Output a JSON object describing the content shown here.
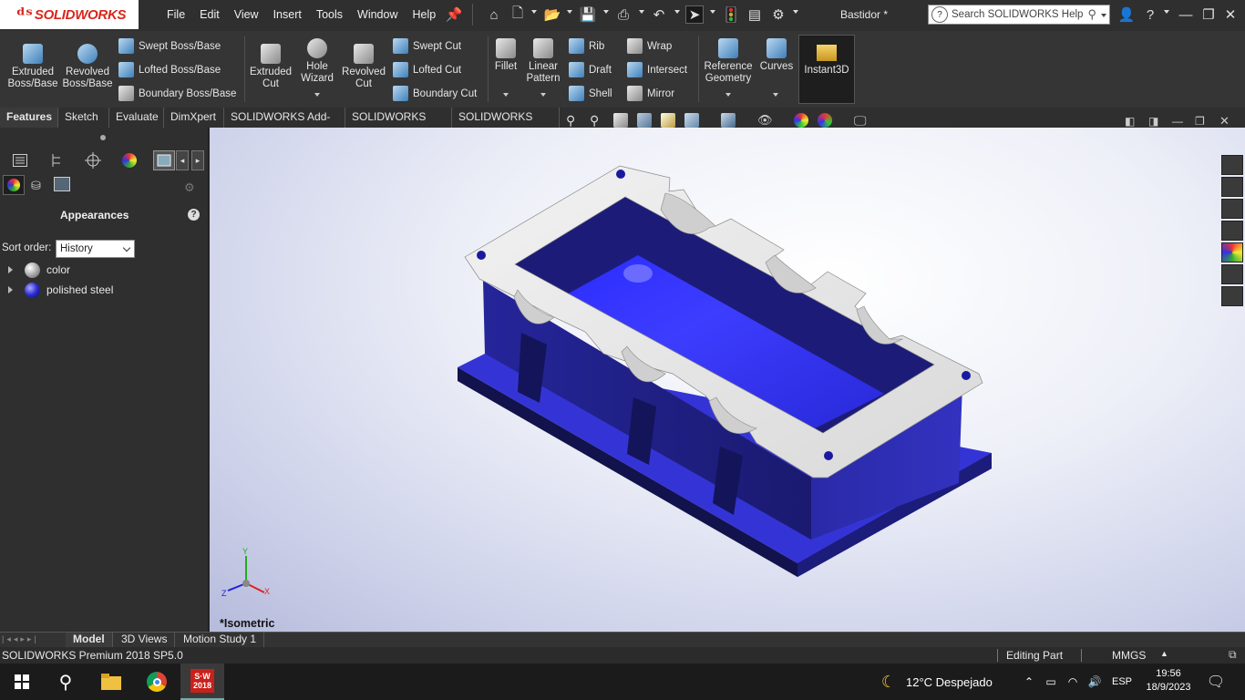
{
  "titlebar": {
    "logo_text": "SOLIDWORKS",
    "menu": [
      "File",
      "Edit",
      "View",
      "Insert",
      "Tools",
      "Window",
      "Help"
    ],
    "document_title": "Bastidor *",
    "search_placeholder": "Search SOLIDWORKS Help"
  },
  "ribbon": {
    "large": [
      {
        "label": "Extruded Boss/Base"
      },
      {
        "label": "Revolved Boss/Base"
      },
      {
        "label": "Extruded Cut"
      },
      {
        "label": "Hole Wizard"
      },
      {
        "label": "Revolved Cut"
      },
      {
        "label": "Fillet"
      },
      {
        "label": "Linear Pattern"
      },
      {
        "label": "Reference Geometry"
      },
      {
        "label": "Curves"
      },
      {
        "label": "Instant3D"
      }
    ],
    "small_boss": [
      "Swept Boss/Base",
      "Lofted Boss/Base",
      "Boundary Boss/Base"
    ],
    "small_cut": [
      "Swept Cut",
      "Lofted Cut",
      "Boundary Cut"
    ],
    "small_features_a": [
      "Rib",
      "Draft",
      "Shell"
    ],
    "small_features_b": [
      "Wrap",
      "Intersect",
      "Mirror"
    ]
  },
  "tabs": [
    "Features",
    "Sketch",
    "Evaluate",
    "DimXpert",
    "SOLIDWORKS Add-Ins",
    "SOLIDWORKS MBD",
    "SOLIDWORKS CAM"
  ],
  "panel": {
    "title": "Appearances",
    "sort_label": "Sort order:",
    "sort_value": "History",
    "items": [
      {
        "label": "color"
      },
      {
        "label": "polished steel"
      }
    ]
  },
  "viewport": {
    "view_label": "*Isometric"
  },
  "bottom_tabs": [
    "Model",
    "3D Views",
    "Motion Study 1"
  ],
  "status": {
    "product": "SOLIDWORKS Premium 2018 SP5.0",
    "mode": "Editing Part",
    "units": "MMGS"
  },
  "taskbar": {
    "weather": "12°C  Despejado",
    "language": "ESP",
    "time": "19:56",
    "date": "18/9/2023",
    "sw_badge": "2018"
  },
  "colors": {
    "part_blue": "#2a2ab0",
    "logo_red": "#d9261c",
    "panel_bg": "#2f2f2f"
  }
}
